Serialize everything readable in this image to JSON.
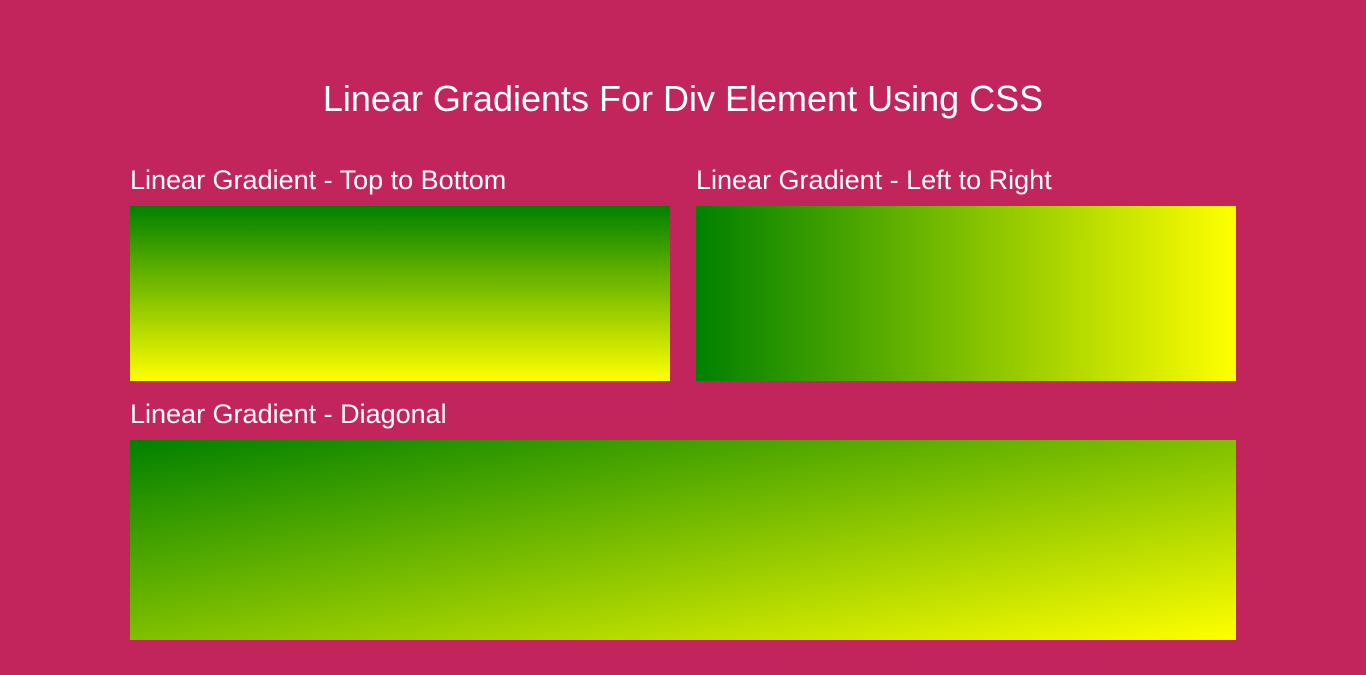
{
  "title": "Linear Gradients For Div Element Using CSS",
  "examples": {
    "topBottom": {
      "heading": "Linear Gradient - Top to Bottom",
      "colorStart": "green",
      "colorEnd": "yellow"
    },
    "leftRight": {
      "heading": "Linear Gradient - Left to Right",
      "colorStart": "green",
      "colorEnd": "yellow"
    },
    "diagonal": {
      "heading": "Linear Gradient - Diagonal",
      "colorStart": "green",
      "colorEnd": "yellow"
    }
  },
  "colors": {
    "background": "#c2255c",
    "text": "#ffffff"
  }
}
